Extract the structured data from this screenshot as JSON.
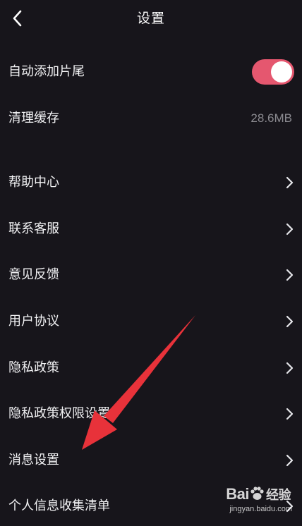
{
  "header": {
    "title": "设置",
    "back_icon": "chevron-left-icon"
  },
  "settings": {
    "auto_outro": {
      "label": "自动添加片尾",
      "enabled": true,
      "toggle_color": "#e5576f"
    },
    "clear_cache": {
      "label": "清理缓存",
      "value": "28.6MB"
    },
    "items": [
      {
        "label": "帮助中心"
      },
      {
        "label": "联系客服"
      },
      {
        "label": "意见反馈"
      },
      {
        "label": "用户协议"
      },
      {
        "label": "隐私政策"
      },
      {
        "label": "隐私政策权限设置"
      },
      {
        "label": "消息设置"
      },
      {
        "label": "个人信息收集清单"
      }
    ]
  },
  "annotation": {
    "color": "#e8323a",
    "points_to": "消息设置"
  },
  "watermark": {
    "logo_text": "Bai",
    "logo_suffix": "经验",
    "url": "jingyan.baidu.com"
  },
  "colors": {
    "background": "#17151b",
    "secondary_text": "#8b8a90"
  }
}
